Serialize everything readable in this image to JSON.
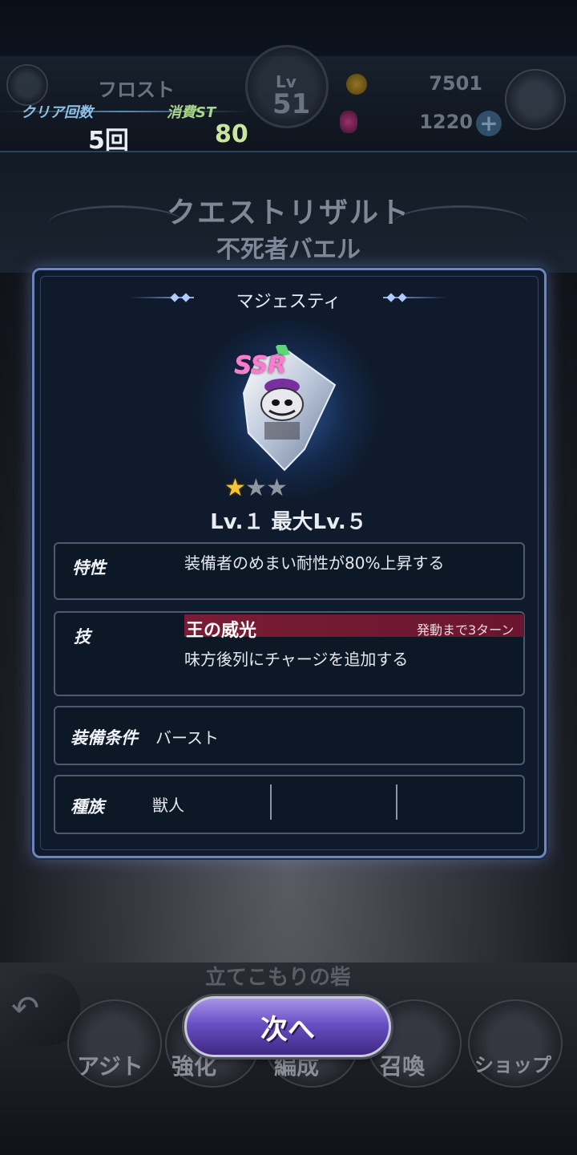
{
  "header": {
    "player_name": "フロスト",
    "level_label": "Lv",
    "level_value": "51",
    "gil": "7501",
    "gems": "1220",
    "clear_count_label": "クリア回数",
    "clear_count_value": "5回",
    "st_cost_label": "消費ST",
    "st_cost_value": "80"
  },
  "banner": {
    "title": "クエストリザルト",
    "subtitle": "不死者バエル"
  },
  "item": {
    "name": "マジェスティ",
    "rarity": "SSR",
    "stars_filled": 1,
    "stars_total": 3,
    "level_text": "Lv.１ 最大Lv.５",
    "trait_label": "特性",
    "trait_text": "装備者のめまい耐性が80%上昇する",
    "skill_label": "技",
    "skill_name": "王の威光",
    "skill_turns": "発動まで3ターン",
    "skill_desc": "味方後列にチャージを追加する",
    "equip_label": "装備条件",
    "equip_value": "バースト",
    "race_label": "種族",
    "race_value": "獣人"
  },
  "footer": {
    "behind_text": "立てこもりの砦",
    "next_button": "次へ",
    "nav": [
      "アジト",
      "強化",
      "編成",
      "召喚",
      "ショップ"
    ]
  },
  "colors": {
    "modal_bg": "#0f1b2d",
    "modal_border": "#6f84b8",
    "skill_bar": "#7a1c34",
    "ssr": "#ff7bd0",
    "star_gold": "#f6c630",
    "next_button": "#6a4fc4"
  }
}
